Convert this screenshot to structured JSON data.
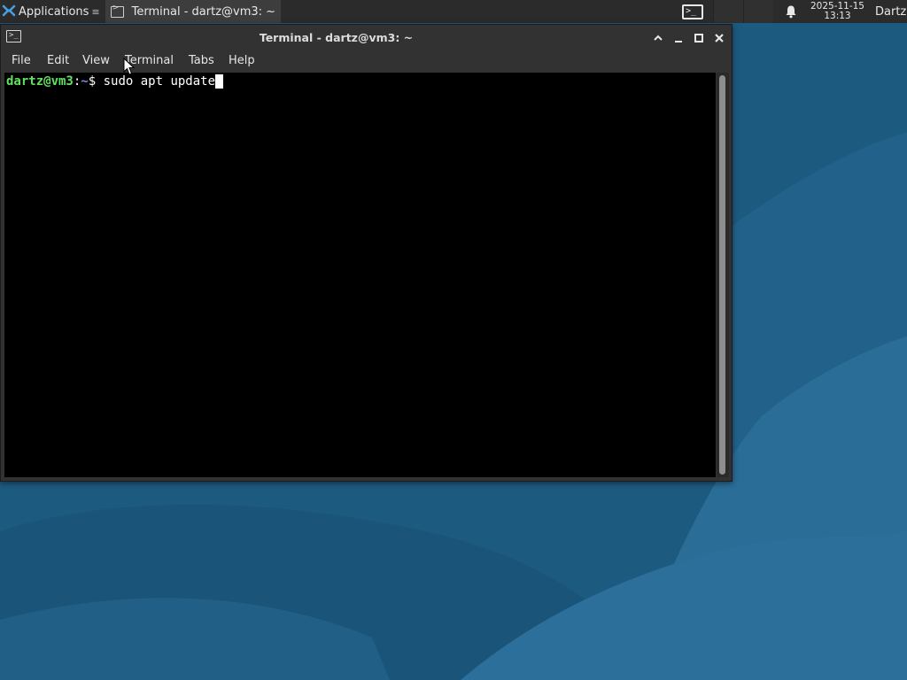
{
  "panel": {
    "applications_label": "Applications",
    "applications_icon": "xfce-logo-icon",
    "task_button_label": "Terminal - dartz@vm3: ~",
    "task_button_icon": "terminal-icon",
    "launcher_icon": "terminal-launcher-icon",
    "notification_icon": "bell-icon",
    "clock_date": "2025-11-15",
    "clock_time": "13:13",
    "user_label": "Dartz"
  },
  "window": {
    "title": "Terminal - dartz@vm3: ~",
    "icon": "terminal-icon",
    "controls": [
      "shade-icon",
      "minimize-icon",
      "maximize-icon",
      "close-icon"
    ],
    "menu": [
      "File",
      "Edit",
      "View",
      "Terminal",
      "Tabs",
      "Help"
    ]
  },
  "terminal": {
    "prompt_user_host": "dartz@vm3",
    "prompt_sep": ":",
    "prompt_path": "~",
    "prompt_symbol": "$ ",
    "command": "sudo apt update"
  },
  "colors": {
    "panel_bg": "#2b2b2b",
    "window_bg": "#323232",
    "terminal_bg": "#000000",
    "prompt_user_color": "#5fe35f",
    "prompt_path_color": "#6d8ff3",
    "desktop_bg": "#1f5b82"
  }
}
